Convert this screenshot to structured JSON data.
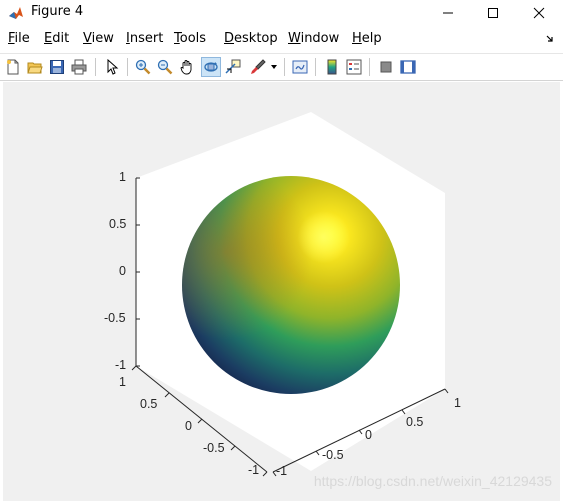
{
  "window": {
    "title": "Figure 4"
  },
  "menu": [
    {
      "label": "File",
      "u": "F",
      "rest": "ile"
    },
    {
      "label": "Edit",
      "u": "E",
      "rest": "dit"
    },
    {
      "label": "View",
      "u": "V",
      "rest": "iew"
    },
    {
      "label": "Insert",
      "u": "I",
      "rest": "nsert"
    },
    {
      "label": "Tools",
      "u": "T",
      "rest": "ools"
    },
    {
      "label": "Desktop",
      "u": "D",
      "rest": "esktop"
    },
    {
      "label": "Window",
      "u": "W",
      "rest": "indow"
    },
    {
      "label": "Help",
      "u": "H",
      "rest": "elp"
    }
  ],
  "toolbar": {
    "icons": [
      "new-figure-icon",
      "open-file-icon",
      "save-icon",
      "print-icon",
      "edit-plot-arrow-icon",
      "zoom-in-icon",
      "zoom-out-icon",
      "pan-hand-icon",
      "rotate-3d-icon",
      "data-cursor-icon",
      "brush-icon",
      "link-plot-icon",
      "colorbar-icon",
      "legend-icon",
      "hide-plot-tools-icon",
      "show-plot-tools-icon"
    ],
    "active": "rotate-3d-icon"
  },
  "axes": {
    "z_ticks": [
      "1",
      "0.5",
      "0",
      "-0.5",
      "-1"
    ],
    "y_ticks": [
      "1",
      "0.5",
      "0",
      "-0.5",
      "-1"
    ],
    "x_ticks": [
      "-1",
      "-0.5",
      "0",
      "0.5",
      "1"
    ]
  },
  "colors": {
    "sphere_top": "#fde725",
    "sphere_mid": "#2a9d5c",
    "sphere_bottom": "#1f2a5e",
    "pane": "#ffffff",
    "figure_bg": "#f0f0f0"
  },
  "watermark": "https://blog.csdn.net/weixin_42129435"
}
